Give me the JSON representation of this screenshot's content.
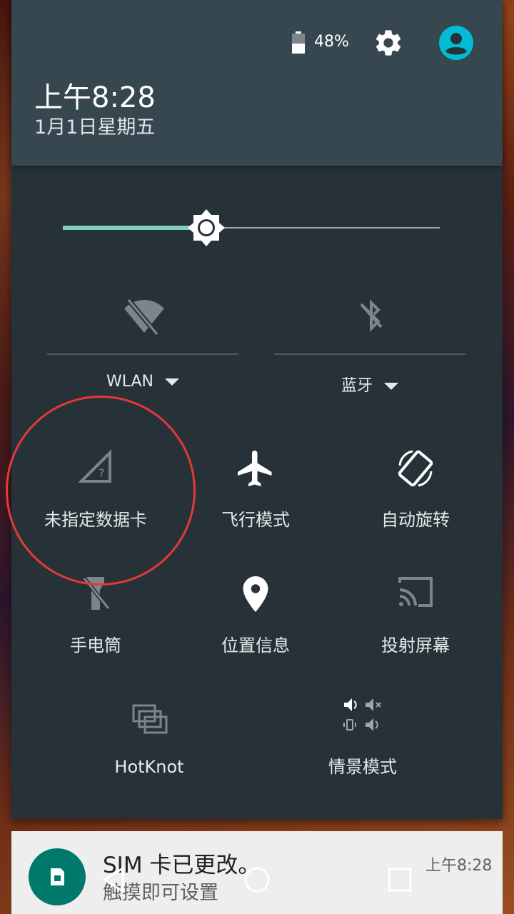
{
  "status": {
    "battery_percent": "48%",
    "battery_level": 0.48
  },
  "header": {
    "time": "上午8:28",
    "date": "1月1日星期五"
  },
  "brightness": {
    "level": 0.37
  },
  "top_tiles": [
    {
      "label": "WLAN",
      "icon": "wifi-off-icon"
    },
    {
      "label": "蓝牙",
      "icon": "bluetooth-off-icon"
    }
  ],
  "tiles": [
    {
      "label": "未指定数据卡",
      "icon": "no-sim-signal-icon"
    },
    {
      "label": "飞行模式",
      "icon": "airplane-icon"
    },
    {
      "label": "自动旋转",
      "icon": "auto-rotate-icon"
    },
    {
      "label": "手电筒",
      "icon": "flashlight-off-icon"
    },
    {
      "label": "位置信息",
      "icon": "location-icon"
    },
    {
      "label": "投射屏幕",
      "icon": "cast-icon"
    },
    {
      "label": "HotKnot",
      "icon": "hotknot-icon"
    },
    {
      "label": "情景模式",
      "icon": "audio-profile-icon"
    }
  ],
  "notification": {
    "title": "SIM 卡已更改。",
    "subtitle": "触摸即可设置",
    "time": "上午8:28",
    "icon": "sim-card-icon"
  },
  "colors": {
    "shade_bg": "#263238",
    "header_bg": "#37474f",
    "accent": "#80cbc4",
    "avatar": "#00bcd4",
    "highlight_circle": "#e53935"
  }
}
